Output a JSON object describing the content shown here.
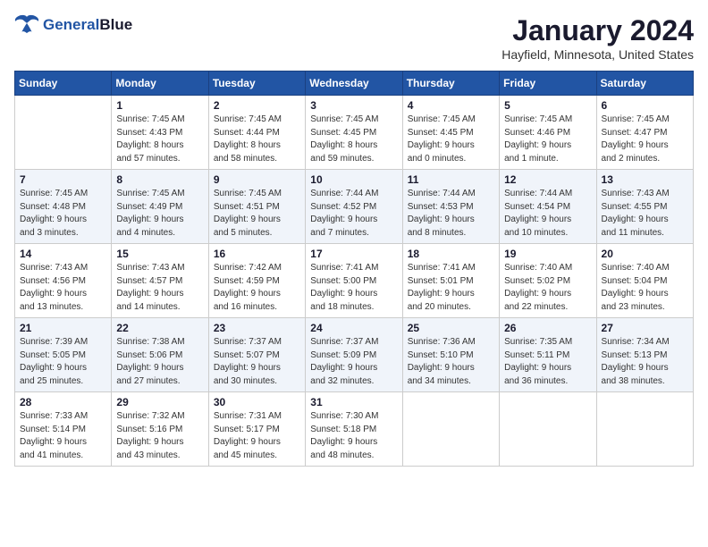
{
  "header": {
    "logo_line1": "General",
    "logo_line2": "Blue",
    "month_year": "January 2024",
    "location": "Hayfield, Minnesota, United States"
  },
  "days_of_week": [
    "Sunday",
    "Monday",
    "Tuesday",
    "Wednesday",
    "Thursday",
    "Friday",
    "Saturday"
  ],
  "weeks": [
    [
      {
        "day": "",
        "info": ""
      },
      {
        "day": "1",
        "info": "Sunrise: 7:45 AM\nSunset: 4:43 PM\nDaylight: 8 hours\nand 57 minutes."
      },
      {
        "day": "2",
        "info": "Sunrise: 7:45 AM\nSunset: 4:44 PM\nDaylight: 8 hours\nand 58 minutes."
      },
      {
        "day": "3",
        "info": "Sunrise: 7:45 AM\nSunset: 4:45 PM\nDaylight: 8 hours\nand 59 minutes."
      },
      {
        "day": "4",
        "info": "Sunrise: 7:45 AM\nSunset: 4:45 PM\nDaylight: 9 hours\nand 0 minutes."
      },
      {
        "day": "5",
        "info": "Sunrise: 7:45 AM\nSunset: 4:46 PM\nDaylight: 9 hours\nand 1 minute."
      },
      {
        "day": "6",
        "info": "Sunrise: 7:45 AM\nSunset: 4:47 PM\nDaylight: 9 hours\nand 2 minutes."
      }
    ],
    [
      {
        "day": "7",
        "info": "Sunrise: 7:45 AM\nSunset: 4:48 PM\nDaylight: 9 hours\nand 3 minutes."
      },
      {
        "day": "8",
        "info": "Sunrise: 7:45 AM\nSunset: 4:49 PM\nDaylight: 9 hours\nand 4 minutes."
      },
      {
        "day": "9",
        "info": "Sunrise: 7:45 AM\nSunset: 4:51 PM\nDaylight: 9 hours\nand 5 minutes."
      },
      {
        "day": "10",
        "info": "Sunrise: 7:44 AM\nSunset: 4:52 PM\nDaylight: 9 hours\nand 7 minutes."
      },
      {
        "day": "11",
        "info": "Sunrise: 7:44 AM\nSunset: 4:53 PM\nDaylight: 9 hours\nand 8 minutes."
      },
      {
        "day": "12",
        "info": "Sunrise: 7:44 AM\nSunset: 4:54 PM\nDaylight: 9 hours\nand 10 minutes."
      },
      {
        "day": "13",
        "info": "Sunrise: 7:43 AM\nSunset: 4:55 PM\nDaylight: 9 hours\nand 11 minutes."
      }
    ],
    [
      {
        "day": "14",
        "info": "Sunrise: 7:43 AM\nSunset: 4:56 PM\nDaylight: 9 hours\nand 13 minutes."
      },
      {
        "day": "15",
        "info": "Sunrise: 7:43 AM\nSunset: 4:57 PM\nDaylight: 9 hours\nand 14 minutes."
      },
      {
        "day": "16",
        "info": "Sunrise: 7:42 AM\nSunset: 4:59 PM\nDaylight: 9 hours\nand 16 minutes."
      },
      {
        "day": "17",
        "info": "Sunrise: 7:41 AM\nSunset: 5:00 PM\nDaylight: 9 hours\nand 18 minutes."
      },
      {
        "day": "18",
        "info": "Sunrise: 7:41 AM\nSunset: 5:01 PM\nDaylight: 9 hours\nand 20 minutes."
      },
      {
        "day": "19",
        "info": "Sunrise: 7:40 AM\nSunset: 5:02 PM\nDaylight: 9 hours\nand 22 minutes."
      },
      {
        "day": "20",
        "info": "Sunrise: 7:40 AM\nSunset: 5:04 PM\nDaylight: 9 hours\nand 23 minutes."
      }
    ],
    [
      {
        "day": "21",
        "info": "Sunrise: 7:39 AM\nSunset: 5:05 PM\nDaylight: 9 hours\nand 25 minutes."
      },
      {
        "day": "22",
        "info": "Sunrise: 7:38 AM\nSunset: 5:06 PM\nDaylight: 9 hours\nand 27 minutes."
      },
      {
        "day": "23",
        "info": "Sunrise: 7:37 AM\nSunset: 5:07 PM\nDaylight: 9 hours\nand 30 minutes."
      },
      {
        "day": "24",
        "info": "Sunrise: 7:37 AM\nSunset: 5:09 PM\nDaylight: 9 hours\nand 32 minutes."
      },
      {
        "day": "25",
        "info": "Sunrise: 7:36 AM\nSunset: 5:10 PM\nDaylight: 9 hours\nand 34 minutes."
      },
      {
        "day": "26",
        "info": "Sunrise: 7:35 AM\nSunset: 5:11 PM\nDaylight: 9 hours\nand 36 minutes."
      },
      {
        "day": "27",
        "info": "Sunrise: 7:34 AM\nSunset: 5:13 PM\nDaylight: 9 hours\nand 38 minutes."
      }
    ],
    [
      {
        "day": "28",
        "info": "Sunrise: 7:33 AM\nSunset: 5:14 PM\nDaylight: 9 hours\nand 41 minutes."
      },
      {
        "day": "29",
        "info": "Sunrise: 7:32 AM\nSunset: 5:16 PM\nDaylight: 9 hours\nand 43 minutes."
      },
      {
        "day": "30",
        "info": "Sunrise: 7:31 AM\nSunset: 5:17 PM\nDaylight: 9 hours\nand 45 minutes."
      },
      {
        "day": "31",
        "info": "Sunrise: 7:30 AM\nSunset: 5:18 PM\nDaylight: 9 hours\nand 48 minutes."
      },
      {
        "day": "",
        "info": ""
      },
      {
        "day": "",
        "info": ""
      },
      {
        "day": "",
        "info": ""
      }
    ]
  ]
}
